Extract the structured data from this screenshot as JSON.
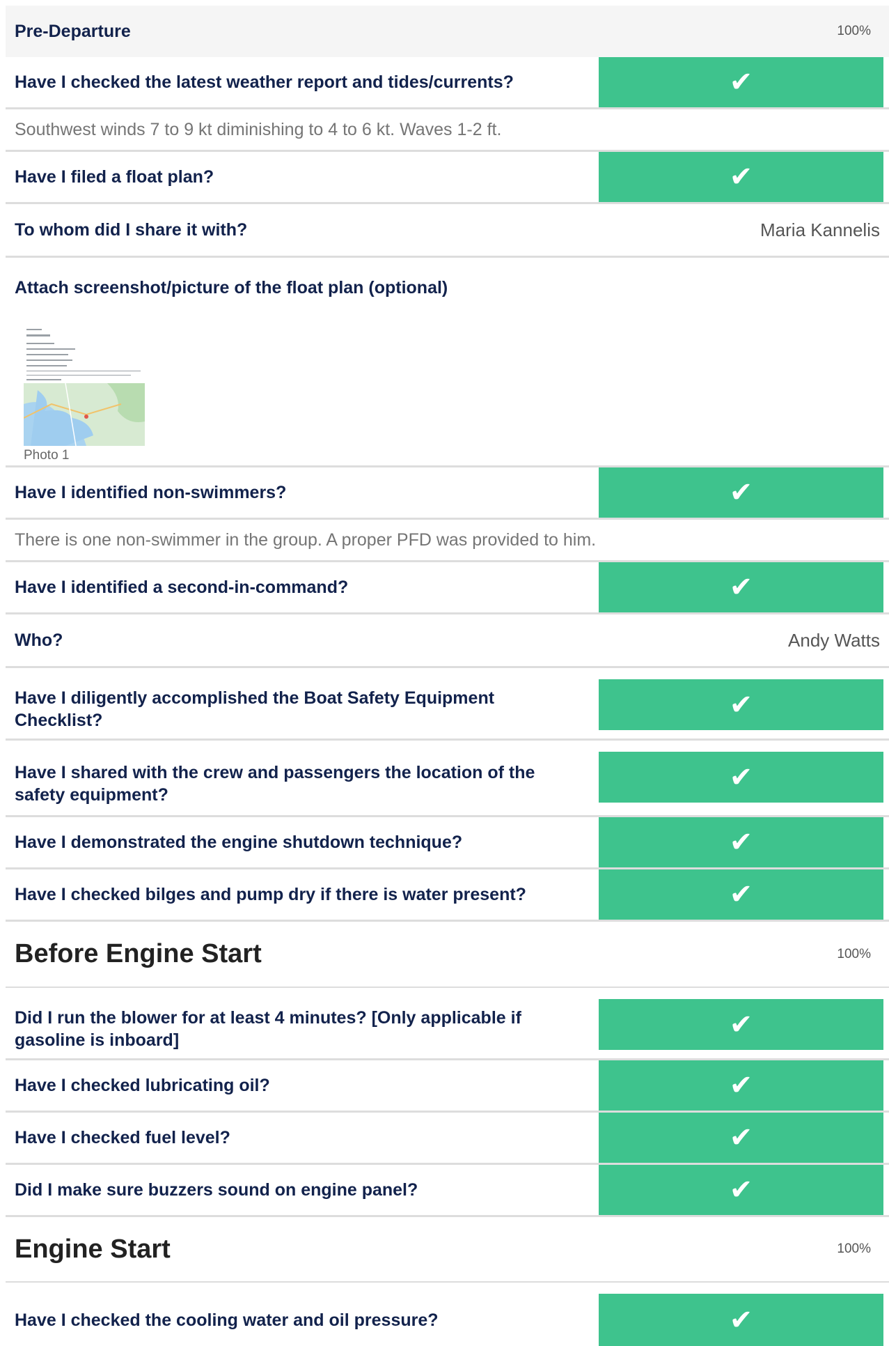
{
  "sections": {
    "pre_departure": {
      "title": "Pre-Departure",
      "percent": "100%"
    },
    "before_engine_start": {
      "title": "Before Engine Start",
      "percent": "100%"
    },
    "engine_start": {
      "title": "Engine Start",
      "percent": "100%"
    }
  },
  "check_mark": "✔",
  "items": {
    "weather": "Have I checked the latest weather report and tides/currents?",
    "weather_note": "Southwest winds 7 to 9 kt diminishing to 4 to 6 kt. Waves 1-2 ft.",
    "float_plan": "Have I filed a float plan?",
    "share_with_q": "To whom did I share it with?",
    "share_with_a": "Maria Kannelis",
    "attach_q": "Attach screenshot/picture of the float plan (optional)",
    "photo_caption": "Photo 1",
    "non_swimmers": "Have I identified non-swimmers?",
    "non_swimmers_note": "There is one non-swimmer in the group. A proper PFD was provided to him.",
    "second_in_command": "Have I identified a second-in-command?",
    "who_q": "Who?",
    "who_a": "Andy Watts",
    "safety_checklist": "Have I diligently accomplished the Boat Safety Equipment Checklist?",
    "shared_location": "Have I shared with the crew and passengers the location of the safety equipment?",
    "engine_shutdown": "Have I demonstrated the engine shutdown technique?",
    "bilges": "Have I checked bilges and pump dry if there is water present?",
    "blower": "Did I run the blower for at least 4 minutes? [Only applicable if gasoline is inboard]",
    "lube_oil": "Have I checked lubricating oil?",
    "fuel_level": "Have I checked fuel level?",
    "buzzers": "Did I make sure buzzers sound on engine panel?",
    "cooling_water": "Have I checked the cooling water and oil pressure?"
  },
  "colors": {
    "accent": "#3ec38d",
    "heading": "#12224c",
    "divider": "#dddddd"
  }
}
